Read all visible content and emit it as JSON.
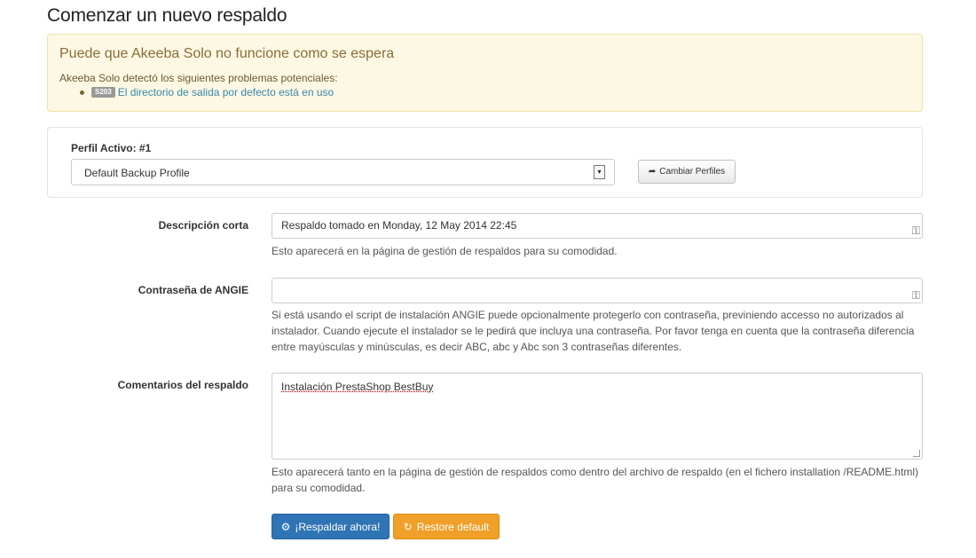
{
  "page": {
    "title": "Comenzar un nuevo respaldo"
  },
  "alert": {
    "title": "Puede que Akeeba Solo no funcione como se espera",
    "description": "Akeeba Solo detectó los siguientes problemas potenciales:",
    "items": [
      {
        "code": "S203",
        "text": "El directorio de salida por defecto está en uso"
      }
    ]
  },
  "profile": {
    "label": "Perfil Activo: #1",
    "selected": "Default Backup Profile",
    "switch_button": "Cambiar Perfiles",
    "switch_icon": "arrow-right-icon"
  },
  "form": {
    "description": {
      "label": "Descripción corta",
      "value": "Respaldo tomado en Monday, 12 May 2014 22:45",
      "help": "Esto aparecerá en la página de gestión de respaldos para su comodidad."
    },
    "angie_password": {
      "label": "Contraseña de ANGIE",
      "value": "",
      "help": "Si está usando el script de instalación ANGIE puede opcionalmente protegerlo con contraseña, previniendo accesso no autorizados al instalador. Cuando ejecute el instalador se le pedirá que incluya una contraseña. Por favor tenga en cuenta que la contraseña diferencia entre mayúsculas y minúsculas, es decir ABC, abc y Abc son 3 contraseñas diferentes."
    },
    "comments": {
      "label": "Comentarios del respaldo",
      "value": "Instalación PrestaShop BestBuy",
      "help": "Esto aparecerá tanto en la página de gestión de respaldos como dentro del archivo de respaldo (en el fichero installation /README.html) para su comodidad."
    }
  },
  "actions": {
    "backup_now": "¡Respaldar ahora!",
    "restore_default": "Restore default",
    "colors": {
      "primary": "#2f74b5",
      "warning": "#f0a029"
    }
  }
}
